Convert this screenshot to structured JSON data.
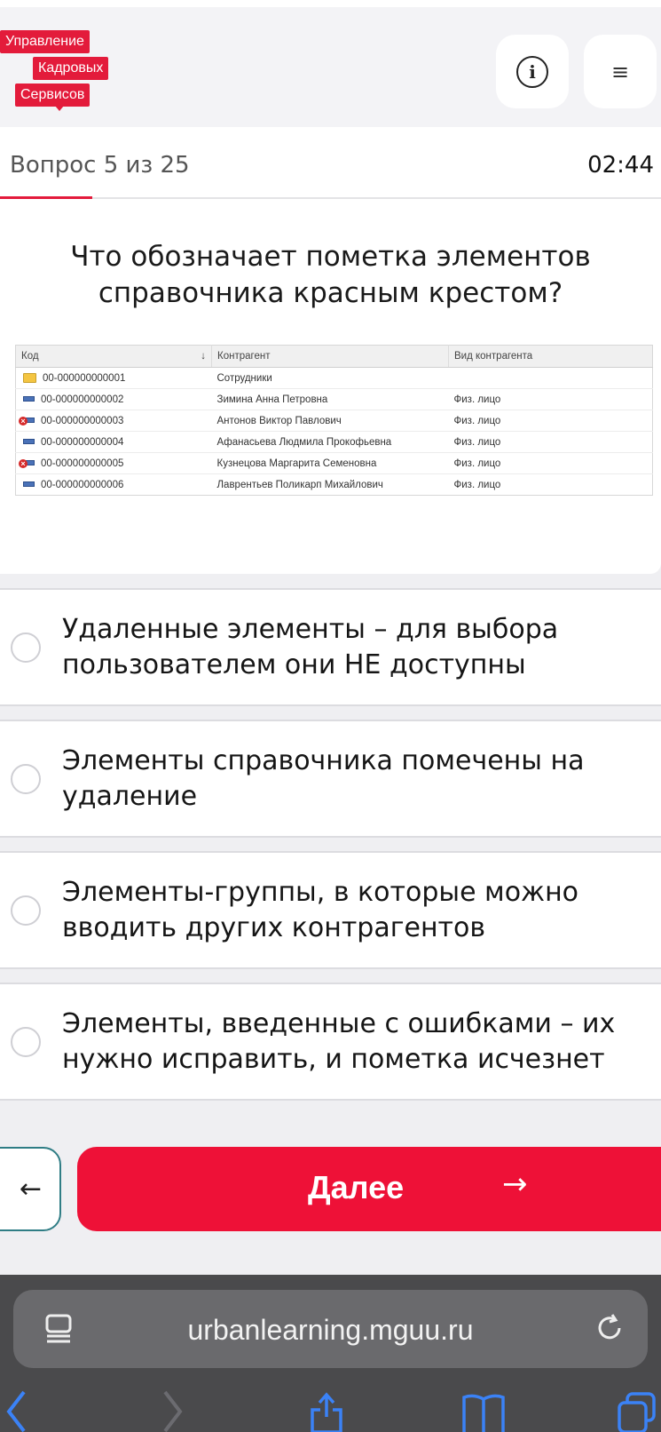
{
  "header": {
    "logo_line1": "Управление",
    "logo_line2": "Кадровых",
    "logo_line3": "Сервисов",
    "info_icon": "i",
    "menu_icon": "≡"
  },
  "progress": {
    "counter": "Вопрос 5 из 25",
    "timer": "02:44",
    "fraction": 0.2
  },
  "question": {
    "text": "Что обозначает пометка элементов справочника красным крестом?"
  },
  "table": {
    "headers": [
      "Код",
      "Контрагент",
      "Вид контрагента"
    ],
    "sort_indicator": "↓",
    "rows": [
      {
        "icon": "folder-icon",
        "code": "00-000000000001",
        "name": "Сотрудники",
        "type": ""
      },
      {
        "icon": "item-icon",
        "code": "00-000000000002",
        "name": "Зимина Анна Петровна",
        "type": "Физ. лицо"
      },
      {
        "icon": "deleted-item-icon",
        "code": "00-000000000003",
        "name": "Антонов Виктор Павлович",
        "type": "Физ. лицо"
      },
      {
        "icon": "item-icon",
        "code": "00-000000000004",
        "name": "Афанасьева Людмила Прокофьевна",
        "type": "Физ. лицо"
      },
      {
        "icon": "deleted-item-icon",
        "code": "00-000000000005",
        "name": "Кузнецова Маргарита Семеновна",
        "type": "Физ. лицо"
      },
      {
        "icon": "item-icon",
        "code": "00-000000000006",
        "name": "Лаврентьев Поликарп Михайлович",
        "type": "Физ. лицо"
      }
    ]
  },
  "answers": [
    {
      "text": "Удаленные элементы – для выбора пользователем они НЕ доступны",
      "selected": false
    },
    {
      "text": "Элементы справочника помечены на удаление",
      "selected": false
    },
    {
      "text": "Элементы-группы, в которые можно вводить других контрагентов",
      "selected": false
    },
    {
      "text": "Элементы, введенные с ошибками – их нужно исправить, и пометка исчезнет",
      "selected": false
    }
  ],
  "nav": {
    "back_icon": "←",
    "next_label": "Далее",
    "next_arrow": "→"
  },
  "browser": {
    "url": "urbanlearning.mguu.ru"
  },
  "colors": {
    "brand_red": "#e31b3b",
    "next_button": "#ee1137",
    "back_border": "#2f7d85"
  }
}
